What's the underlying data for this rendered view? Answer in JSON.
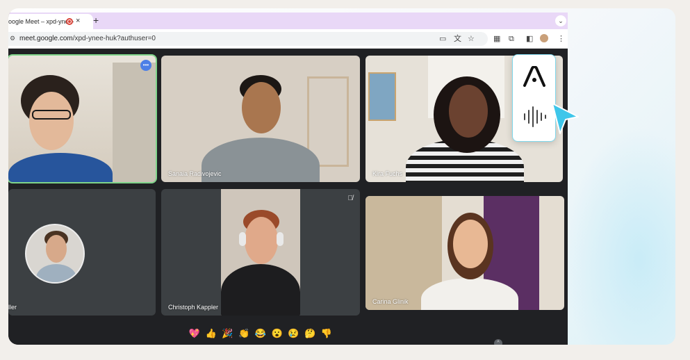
{
  "browser": {
    "tab_title": "oogle Meet – xpd-ynee-",
    "tab_close": "×",
    "new_tab": "+",
    "tab_menu": "⌄",
    "url_host": "meet.google.com",
    "url_path": "/xpd-ynee-huk?authuser=0",
    "toolbar_icons": [
      "camera-icon",
      "translate-icon",
      "star-icon",
      "extension-a-icon",
      "puzzle-icon",
      "sidebar-icon",
      "profile-avatar",
      "menu-dots-icon"
    ]
  },
  "meet": {
    "participants": [
      {
        "name": "",
        "speaking": true
      },
      {
        "name": "Sanaia Radivojevic"
      },
      {
        "name": "Kira Fuchs"
      },
      {
        "name": "ller"
      },
      {
        "name": "Christoph Kappler",
        "muted": true
      },
      {
        "name": "Carina Glinik"
      }
    ],
    "reactions": [
      "💖",
      "👍",
      "🎉",
      "👏",
      "😂",
      "😮",
      "😢",
      "🤔",
      "👎"
    ],
    "scroll_up": "^"
  },
  "colors": {
    "background": "#f2efeb",
    "tab_strip": "#e9d8f7",
    "meet_bg": "#202124",
    "tile_bg": "#3c4043",
    "active_border": "#7fd48a",
    "speaking_badge": "#4d7fe6",
    "accent_cursor": "#3ec6ea"
  },
  "extension": {
    "logo_icon": "a-logo-icon",
    "voice_icon": "waveform-icon",
    "cursor_icon": "pointer-cursor-icon"
  }
}
